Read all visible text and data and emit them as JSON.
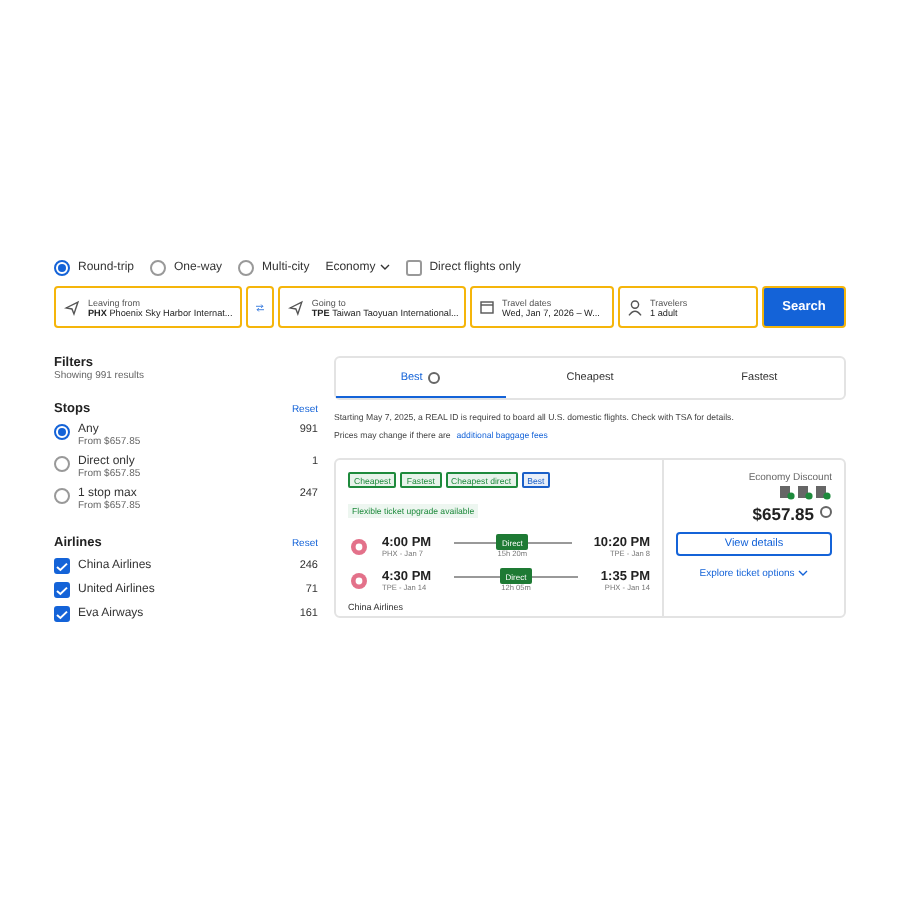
{
  "trip_types": [
    {
      "label": "Round-trip",
      "selected": true
    },
    {
      "label": "One-way",
      "selected": false
    },
    {
      "label": "Multi-city",
      "selected": false
    }
  ],
  "cabin": "Economy",
  "direct_only": {
    "label": "Direct flights only",
    "checked": false
  },
  "search_fields": [
    {
      "kind": "place",
      "label": "Leaving from",
      "code": "PHX",
      "value": "Phoenix Sky Harbor Internat..."
    },
    {
      "kind": "swap"
    },
    {
      "kind": "place",
      "label": "Going to",
      "code": "TPE",
      "value": "Taiwan Taoyuan International..."
    },
    {
      "kind": "dates",
      "label": "Travel dates",
      "value": "Wed, Jan 7, 2026 – W..."
    },
    {
      "kind": "travelers",
      "label": "Travelers",
      "value": "1 adult"
    }
  ],
  "search_button": "Search",
  "filters": {
    "title": "Filters",
    "count": "Showing 991 results",
    "stops": {
      "title": "Stops",
      "reset": "Reset",
      "options": [
        {
          "label": "Any",
          "from": "From $657.85",
          "count": "991",
          "selected": true
        },
        {
          "label": "Direct only",
          "from": "From $657.85",
          "count": "1",
          "selected": false
        },
        {
          "label": "1 stop max",
          "from": "From $657.85",
          "count": "247",
          "selected": false
        }
      ]
    },
    "airlines": {
      "title": "Airlines",
      "reset": "Reset",
      "items": [
        {
          "label": "China Airlines",
          "count": "246",
          "checked": true
        },
        {
          "label": "United Airlines",
          "count": "71",
          "checked": true
        },
        {
          "label": "Eva Airways",
          "count": "161",
          "checked": true
        }
      ]
    }
  },
  "sort_tabs": [
    {
      "label": "Best",
      "info": true,
      "selected": true
    },
    {
      "label": "Cheapest",
      "info": false,
      "selected": false
    },
    {
      "label": "Fastest",
      "info": false,
      "selected": false
    }
  ],
  "notice": "Starting May 7, 2025, a REAL ID is required to board all U.S. domestic flights. Check with TSA for details.",
  "price_note": {
    "text": "Prices may change if there are",
    "link": "additional baggage fees"
  },
  "flight": {
    "tags": [
      {
        "label": "Cheapest",
        "color": "#1e8a3c"
      },
      {
        "label": "Fastest",
        "color": "#1e8a3c"
      },
      {
        "label": "Cheapest direct",
        "color": "#1e8a3c"
      },
      {
        "label": "Best",
        "color": "#1a5fc8"
      }
    ],
    "perk": "Flexible ticket upgrade available",
    "legs": [
      {
        "depart": "4:00 PM",
        "depart_sub": "PHX - Jan 7",
        "stops": "Direct",
        "duration": "15h 20m",
        "arrive": "10:20 PM",
        "arrive_sub": "TPE - Jan 8"
      },
      {
        "depart": "4:30 PM",
        "depart_sub": "TPE - Jan 14",
        "stops": "Direct",
        "duration": "12h 05m",
        "arrive": "1:35 PM",
        "arrive_sub": "PHX - Jan 14"
      }
    ],
    "airline": "China Airlines",
    "fare": {
      "cabin": "Economy Discount",
      "price": "$657.85",
      "button": "View details",
      "link": "Explore ticket options"
    }
  }
}
